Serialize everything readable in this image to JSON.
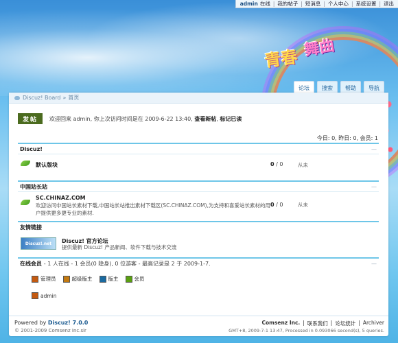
{
  "topbar": {
    "username": "admin",
    "status": "在线",
    "links": [
      "我的帖子",
      "短消息",
      "个人中心",
      "系统设置",
      "退出"
    ]
  },
  "nav": {
    "tabs": [
      "论坛",
      "搜索",
      "帮助",
      "导航"
    ]
  },
  "breadcrumb": {
    "board": "Discuz! Board",
    "sep": "»",
    "current": "首页"
  },
  "welcome": {
    "post_button": "发帖",
    "message": "欢迎回来 admin, 你上次访问时间是在  2009-6-22 13:40,",
    "link1": "查看新帖",
    "link2": "标记已读"
  },
  "stats": "今日: 0, 昨日: 0, 会员: 1",
  "sections": {
    "discuz": {
      "title": "Discuz!",
      "forum_name": "默认版块",
      "threads": "0",
      "slash": " / ",
      "posts": "0",
      "lastpost": "从未"
    },
    "chinaz": {
      "title": "中国站长站",
      "forum_name": "SC.CHINAZ.COM",
      "forum_desc": "欢迎访问中国站长素材下载,中国站长站推出素材下载区(SC.CHINAZ.COM),为支持和喜爱站长素材的用户提供更多更专业的素材.",
      "threads": "0",
      "slash": " / ",
      "posts": "0",
      "lastpost": "从未"
    },
    "links": {
      "title": "友情链接",
      "logo_text": "Discuz!.net",
      "name": "Discuz! 官方论坛",
      "desc": "提供最新 Discuz! 产品新闻、软件下载与技术交流"
    },
    "online": {
      "title": "在线会员",
      "summary": "- 1 人在线  - 1 会员(0 隐身), 0 位游客  - 最高记录是 2 于  2009-1-7.",
      "legend": [
        "管理员",
        "超级版主",
        "版主",
        "会员"
      ],
      "user": "admin"
    }
  },
  "footer": {
    "powered_prefix": "Powered by",
    "product": "Discuz! 7.0.0",
    "copyright": "© 2001-2009 Comsenz Inc.sir",
    "company": "Comsenz Inc.",
    "links": [
      "联系我们",
      "论坛统计",
      "Archiver"
    ],
    "meta": "GMT+8, 2009-7-1 13:47, Processed in 0.093066 second(s), 5 queries."
  }
}
